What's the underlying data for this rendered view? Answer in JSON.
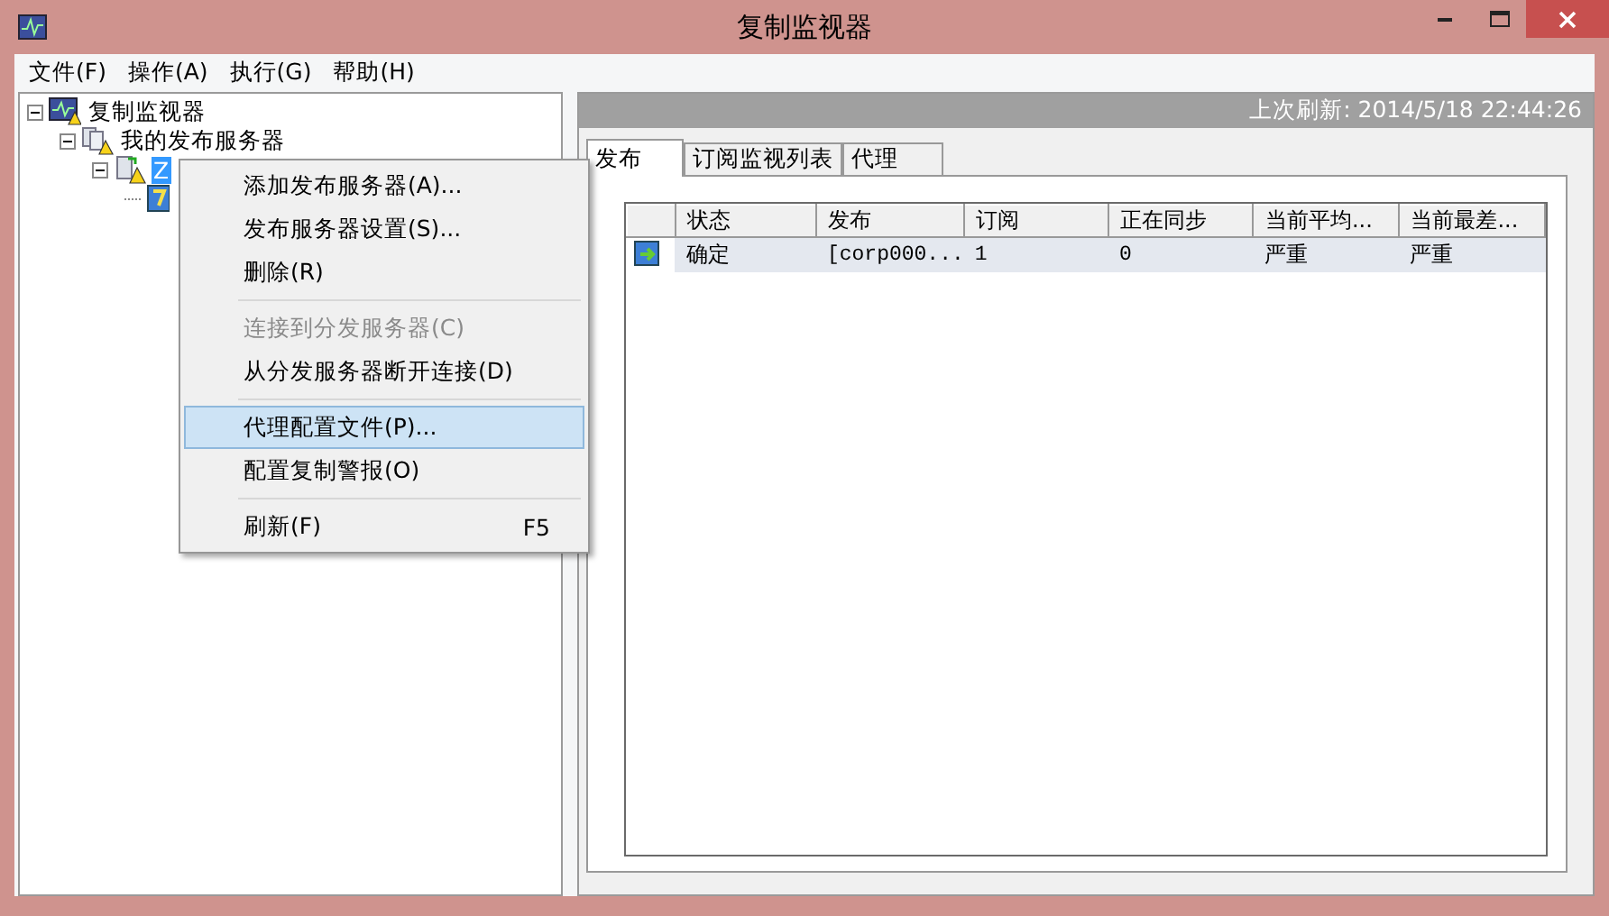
{
  "window": {
    "title": "复制监视器"
  },
  "menu_bar": [
    "文件(F)",
    "操作(A)",
    "执行(G)",
    "帮助(H)"
  ],
  "tree": [
    {
      "label": "复制监视器",
      "kind": "monitor",
      "expanded": true,
      "selected": false,
      "children": [
        {
          "label": "我的发布服务器",
          "kind": "group",
          "expanded": true,
          "selected": false,
          "children": [
            {
              "label": "Z",
              "kind": "server",
              "expanded": true,
              "selected": true,
              "children": [
                {
                  "kind": "publication",
                  "selected": false
                }
              ]
            }
          ]
        }
      ]
    }
  ],
  "header": {
    "last_refresh": "上次刷新: 2014/5/18 22:44:26"
  },
  "tabs": [
    {
      "label": "发布",
      "selected": true
    },
    {
      "label": "订阅监视列表",
      "selected": false
    },
    {
      "label": "代理",
      "selected": false
    }
  ],
  "table": {
    "columns": [
      "状态",
      "发布",
      "订阅",
      "正在同步",
      "当前平均...",
      "当前最差..."
    ],
    "rows": [
      {
        "selected": true,
        "cells": [
          "确定",
          "[corp000...",
          "1",
          "0",
          "严重",
          "严重"
        ]
      }
    ]
  },
  "context_menu": [
    {
      "kind": "item",
      "label": "添加发布服务器(A)...",
      "disabled": false,
      "selected": false
    },
    {
      "kind": "item",
      "label": "发布服务器设置(S)...",
      "disabled": false,
      "selected": false
    },
    {
      "kind": "item",
      "label": "删除(R)",
      "disabled": false,
      "selected": false
    },
    {
      "kind": "separator"
    },
    {
      "kind": "item",
      "label": "连接到分发服务器(C)",
      "disabled": true,
      "selected": false
    },
    {
      "kind": "item",
      "label": "从分发服务器断开连接(D)",
      "disabled": false,
      "selected": false
    },
    {
      "kind": "separator"
    },
    {
      "kind": "item",
      "label": "代理配置文件(P)...",
      "disabled": false,
      "selected": true
    },
    {
      "kind": "item",
      "label": "配置复制警报(O)",
      "disabled": false,
      "selected": false
    },
    {
      "kind": "separator"
    },
    {
      "kind": "item",
      "label": "刷新(F)",
      "shortcut": "F5",
      "disabled": false,
      "selected": false
    }
  ]
}
